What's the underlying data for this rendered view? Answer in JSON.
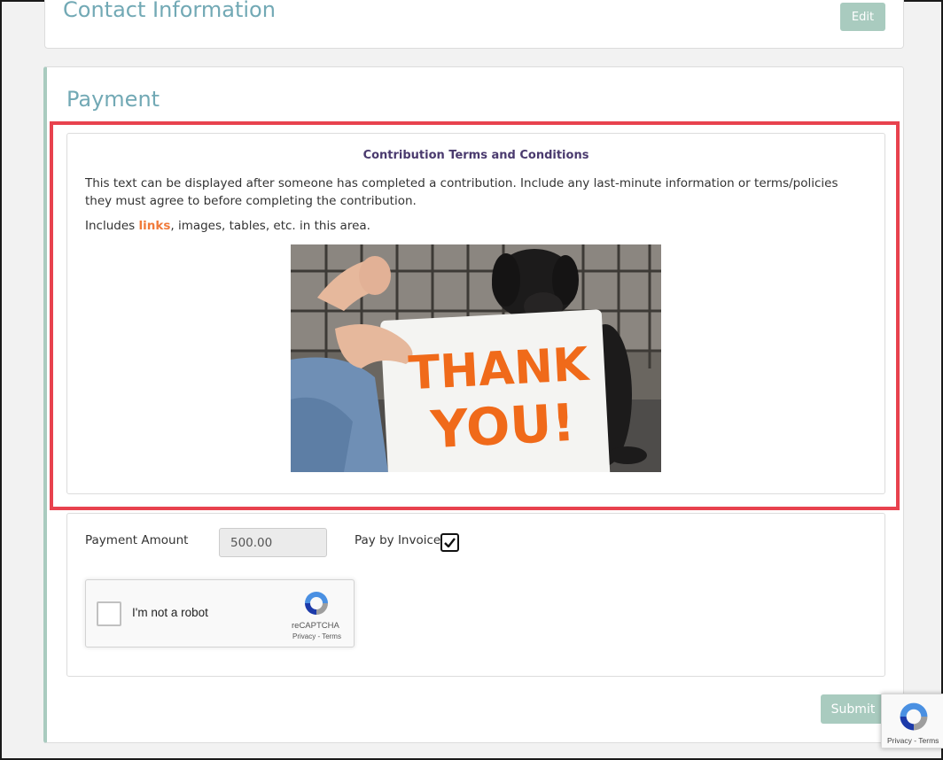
{
  "contact": {
    "title": "Contact Information",
    "edit_label": "Edit"
  },
  "payment": {
    "title": "Payment",
    "terms": {
      "heading": "Contribution Terms and Conditions",
      "paragraph": "This text can be displayed after someone has completed a contribution. Include any last-minute information or terms/policies they must agree to before completing the contribution.",
      "links_prefix": "Includes ",
      "links_link": "links",
      "links_suffix": ", images, tables, etc. in this area.",
      "image_text_line1": "THANK",
      "image_text_line2": "YOU!"
    },
    "amount_label": "Payment Amount",
    "amount_value": "500.00",
    "invoice_label": "Pay by Invoice",
    "invoice_checked": true,
    "submit_label": "Submit"
  },
  "recaptcha": {
    "label": "I'm not a robot",
    "brand": "reCAPTCHA",
    "links": "Privacy - Terms",
    "badge_links": "Privacy - Terms"
  },
  "colors": {
    "accent": "#72a9b5",
    "button": "#a9cbbf",
    "highlight": "#e8424e",
    "link": "#f07a3a",
    "heading": "#4a3a6e"
  }
}
